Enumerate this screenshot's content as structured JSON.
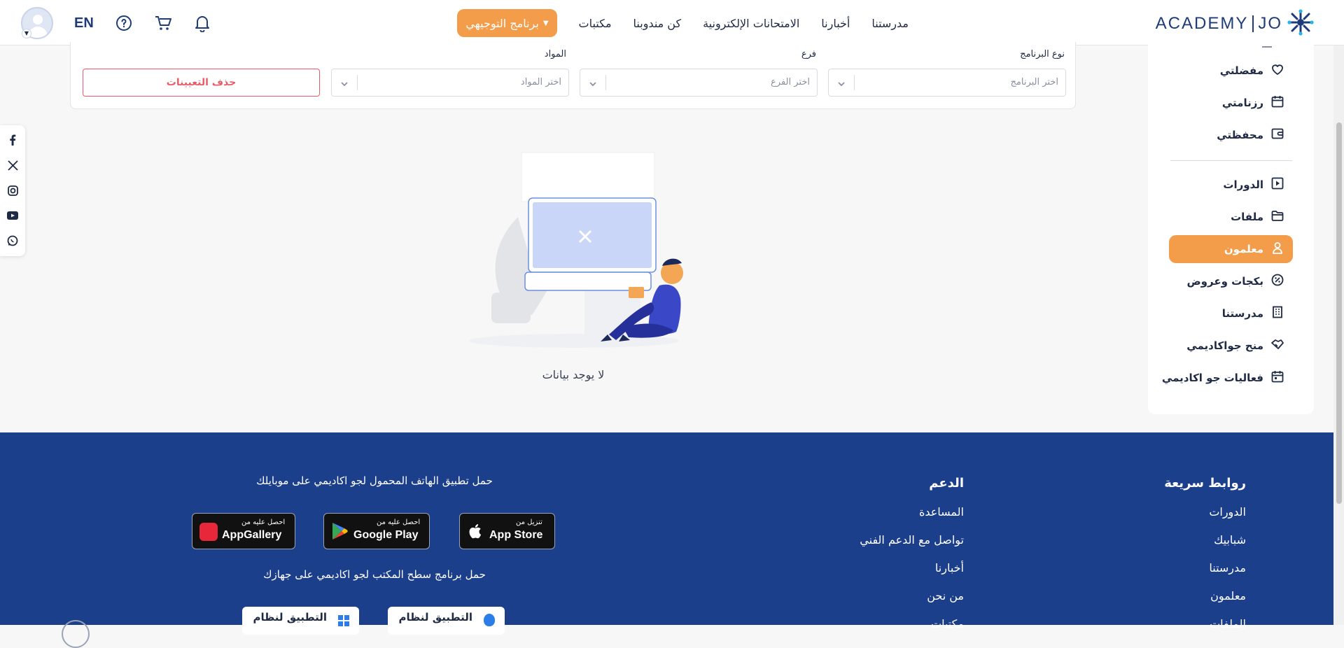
{
  "header": {
    "lang": "EN",
    "nav": [
      "مدرستنا",
      "أخبارنا",
      "الامتحانات الإلكترونية",
      "كن مندوبنا",
      "مكتبات"
    ],
    "nav_button": "برنامج التوجيهي",
    "logo_left": "JO",
    "logo_right": "ACADEMY",
    "icons": [
      "avatar",
      "help-icon",
      "cart-icon",
      "bell-icon"
    ]
  },
  "filters": {
    "program_label": "نوع البرنامج",
    "program_placeholder": "اختر البرنامج",
    "branch_label": "فرع",
    "branch_placeholder": "اختر الفرع",
    "subjects_label": "المواد",
    "subjects_placeholder": "اختر المواد",
    "clear_button": "حذف التعيينات"
  },
  "empty_state": {
    "text": "لا يوجد بيانات"
  },
  "sidebar": {
    "items": [
      {
        "label": "مفضلتي",
        "icon": "heart-icon"
      },
      {
        "label": "رزنامتي",
        "icon": "calendar-icon"
      },
      {
        "label": "محفظتي",
        "icon": "wallet-icon"
      },
      {
        "label": "الدورات",
        "icon": "play-icon"
      },
      {
        "label": "ملفات",
        "icon": "folder-icon"
      },
      {
        "label": "معلمون",
        "icon": "teacher-icon",
        "active": true
      },
      {
        "label": "بكجات وعروض",
        "icon": "discount-icon"
      },
      {
        "label": "مدرستنا",
        "icon": "building-icon"
      },
      {
        "label": "منح جواكاديمي",
        "icon": "handshake-icon"
      },
      {
        "label": "فعاليات جو اكاديمي",
        "icon": "event-icon"
      }
    ]
  },
  "social": [
    "facebook-icon",
    "x-icon",
    "instagram-icon",
    "youtube-icon",
    "whatsapp-icon"
  ],
  "footer": {
    "quick_links_title": "روابط سريعة",
    "quick_links": [
      "الدورات",
      "شبابيك",
      "مدرستنا",
      "معلمون",
      "الملفات"
    ],
    "support_title": "الدعم",
    "support_links": [
      "المساعدة",
      "تواصل مع الدعم الفني",
      "أخبارنا",
      "من نحن",
      "مكتبات"
    ],
    "mobile_text": "حمل تطبيق الهاتف المحمول لجو اكاديمي على موبايلك",
    "stores": [
      {
        "small": "تنزيل من",
        "big": "App Store"
      },
      {
        "small": "احصل عليه من",
        "big": "Google Play"
      },
      {
        "small": "احصل عليه من",
        "big": "AppGallery"
      }
    ],
    "desktop_text": "حمل برنامج سطح المكتب لجو اكاديمي على جهازك",
    "desktop_buttons": [
      "التطبيق لنظام",
      "التطبيق لنظام"
    ]
  },
  "colors": {
    "accent": "#f39c4a",
    "brand": "#1c3f8c",
    "danger": "#e85c6a"
  }
}
